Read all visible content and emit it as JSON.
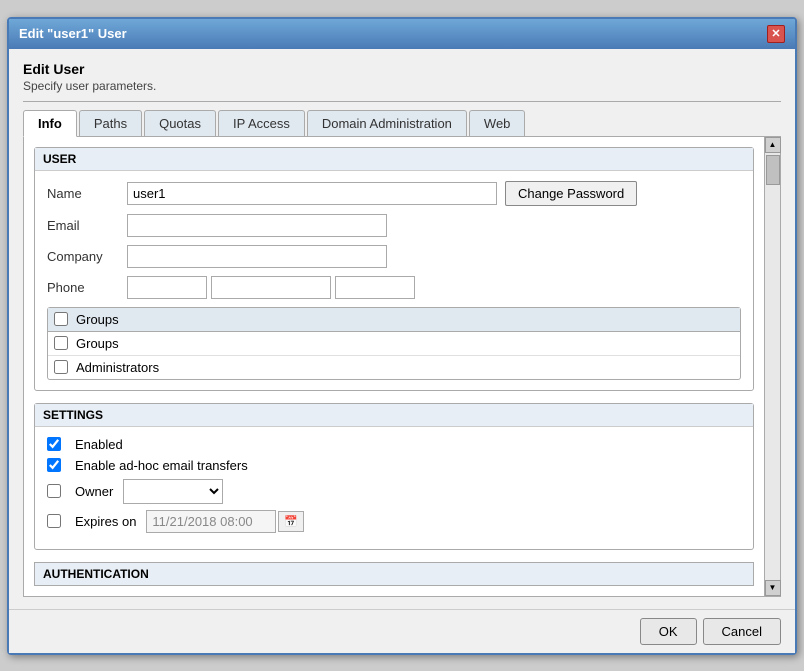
{
  "dialog": {
    "title": "Edit \"user1\" User",
    "close_label": "✕"
  },
  "header": {
    "heading": "Edit User",
    "subheading": "Specify user parameters."
  },
  "tabs": [
    {
      "id": "info",
      "label": "Info",
      "active": true
    },
    {
      "id": "paths",
      "label": "Paths",
      "active": false
    },
    {
      "id": "quotas",
      "label": "Quotas",
      "active": false
    },
    {
      "id": "ip-access",
      "label": "IP Access",
      "active": false
    },
    {
      "id": "domain-admin",
      "label": "Domain Administration",
      "active": false
    },
    {
      "id": "web",
      "label": "Web",
      "active": false
    }
  ],
  "user_section": {
    "header": "USER",
    "name_label": "Name",
    "name_value": "user1",
    "change_password_label": "Change Password",
    "email_label": "Email",
    "email_value": "",
    "company_label": "Company",
    "company_value": "",
    "phone_label": "Phone",
    "phone_part1": "",
    "phone_part2": "",
    "phone_part3": "",
    "groups_header": "Groups",
    "groups": [
      {
        "label": "Groups",
        "checked": false
      },
      {
        "label": "Administrators",
        "checked": false
      }
    ]
  },
  "settings_section": {
    "header": "SETTINGS",
    "enabled_label": "Enabled",
    "enabled_checked": true,
    "adhoc_label": "Enable ad-hoc email transfers",
    "adhoc_checked": true,
    "owner_label": "Owner",
    "owner_checked": false,
    "expires_label": "Expires on",
    "expires_checked": false,
    "expires_value": "11/21/2018 08:00",
    "calendar_icon": "📅"
  },
  "authentication_section": {
    "header": "AUTHENTICATION"
  },
  "footer": {
    "ok_label": "OK",
    "cancel_label": "Cancel"
  }
}
